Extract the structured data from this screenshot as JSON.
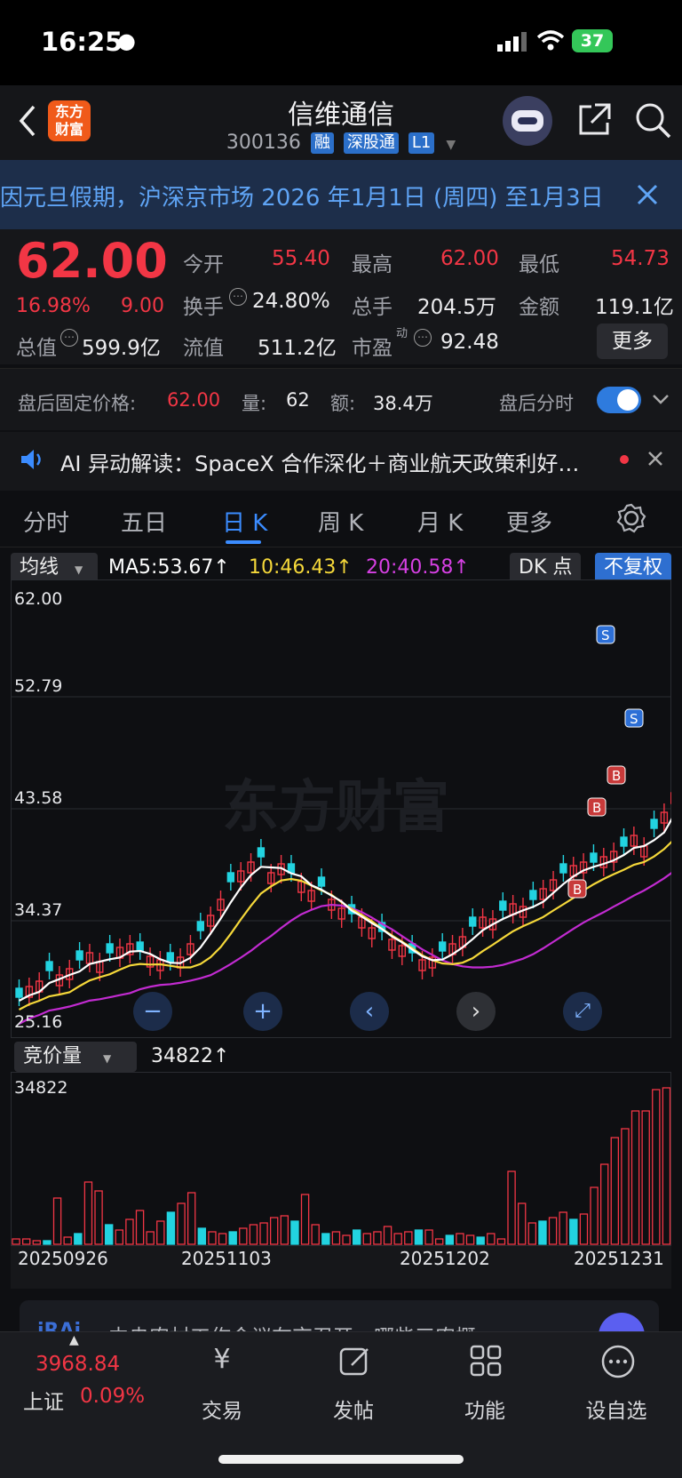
{
  "status_bar": {
    "time": "16:25",
    "battery": "37"
  },
  "header": {
    "logo_text": "东方\n财富",
    "stock_name": "信维通信",
    "stock_code": "300136",
    "tags": [
      "融",
      "深股通",
      "L1"
    ]
  },
  "notice": {
    "text": "因元旦假期，沪深京市场 2026 年1月1日 (周四) 至1月3日"
  },
  "quote": {
    "price": "62.00",
    "change_pct": "16.98%",
    "change": "9.00",
    "open_label": "今开",
    "open": "55.40",
    "high_label": "最高",
    "high": "62.00",
    "low_label": "最低",
    "low": "54.73",
    "turnover_label": "换手",
    "turnover": "24.80%",
    "volume_label": "总手",
    "volume": "204.5万",
    "amount_label": "金额",
    "amount": "119.1亿",
    "mktcap_label": "总值",
    "mktcap": "599.9亿",
    "float_label": "流值",
    "float_cap": "511.2亿",
    "pe_label": "市盈",
    "pe_sup": "动",
    "pe": "92.48",
    "more_label": "更多"
  },
  "after_hours": {
    "price_label": "盘后固定价格:",
    "price": "62.00",
    "vol_label": "量:",
    "vol": "62",
    "amt_label": "额:",
    "amt": "38.4万",
    "intraday_label": "盘后分时"
  },
  "ai_strip": {
    "text": "AI 异动解读：SpaceX 合作深化＋商业航天政策利好…"
  },
  "tabs": [
    {
      "label": "分时"
    },
    {
      "label": "五日"
    },
    {
      "label": "日 K"
    },
    {
      "label": "周 K"
    },
    {
      "label": "月 K"
    },
    {
      "label": "更多"
    }
  ],
  "kline": {
    "indicator_label": "均线",
    "ma5": "MA5:53.67↑",
    "ma10": "10:46.43↑",
    "ma20": "20:40.58↑",
    "dk_label": "DK 点",
    "adjust_label": "不复权",
    "y_labels": [
      "62.00",
      "52.79",
      "43.58",
      "34.37",
      "25.16"
    ],
    "watermark": "东方财富",
    "markers": [
      "S",
      "S",
      "B",
      "B",
      "B"
    ]
  },
  "volume": {
    "indicator_label": "竞价量",
    "value": "34822↑",
    "max_label": "34822",
    "dates": [
      "20250926",
      "20251103",
      "20251202",
      "20251231"
    ]
  },
  "banner": {
    "text": "中央农村工作会议在京召开，哪些三农概"
  },
  "bottom_nav": {
    "index_value": "3968.84",
    "index_name": "上证",
    "index_pct": "0.09%",
    "items": [
      {
        "label": "交易"
      },
      {
        "label": "发帖"
      },
      {
        "label": "功能"
      },
      {
        "label": "设自选"
      }
    ]
  },
  "colors": {
    "up": "#f23645",
    "down": "#22d3e0",
    "ma5": "#ffffff",
    "ma10": "#f5d83a",
    "ma20": "#c22bd1",
    "accent": "#3b8cff"
  }
}
